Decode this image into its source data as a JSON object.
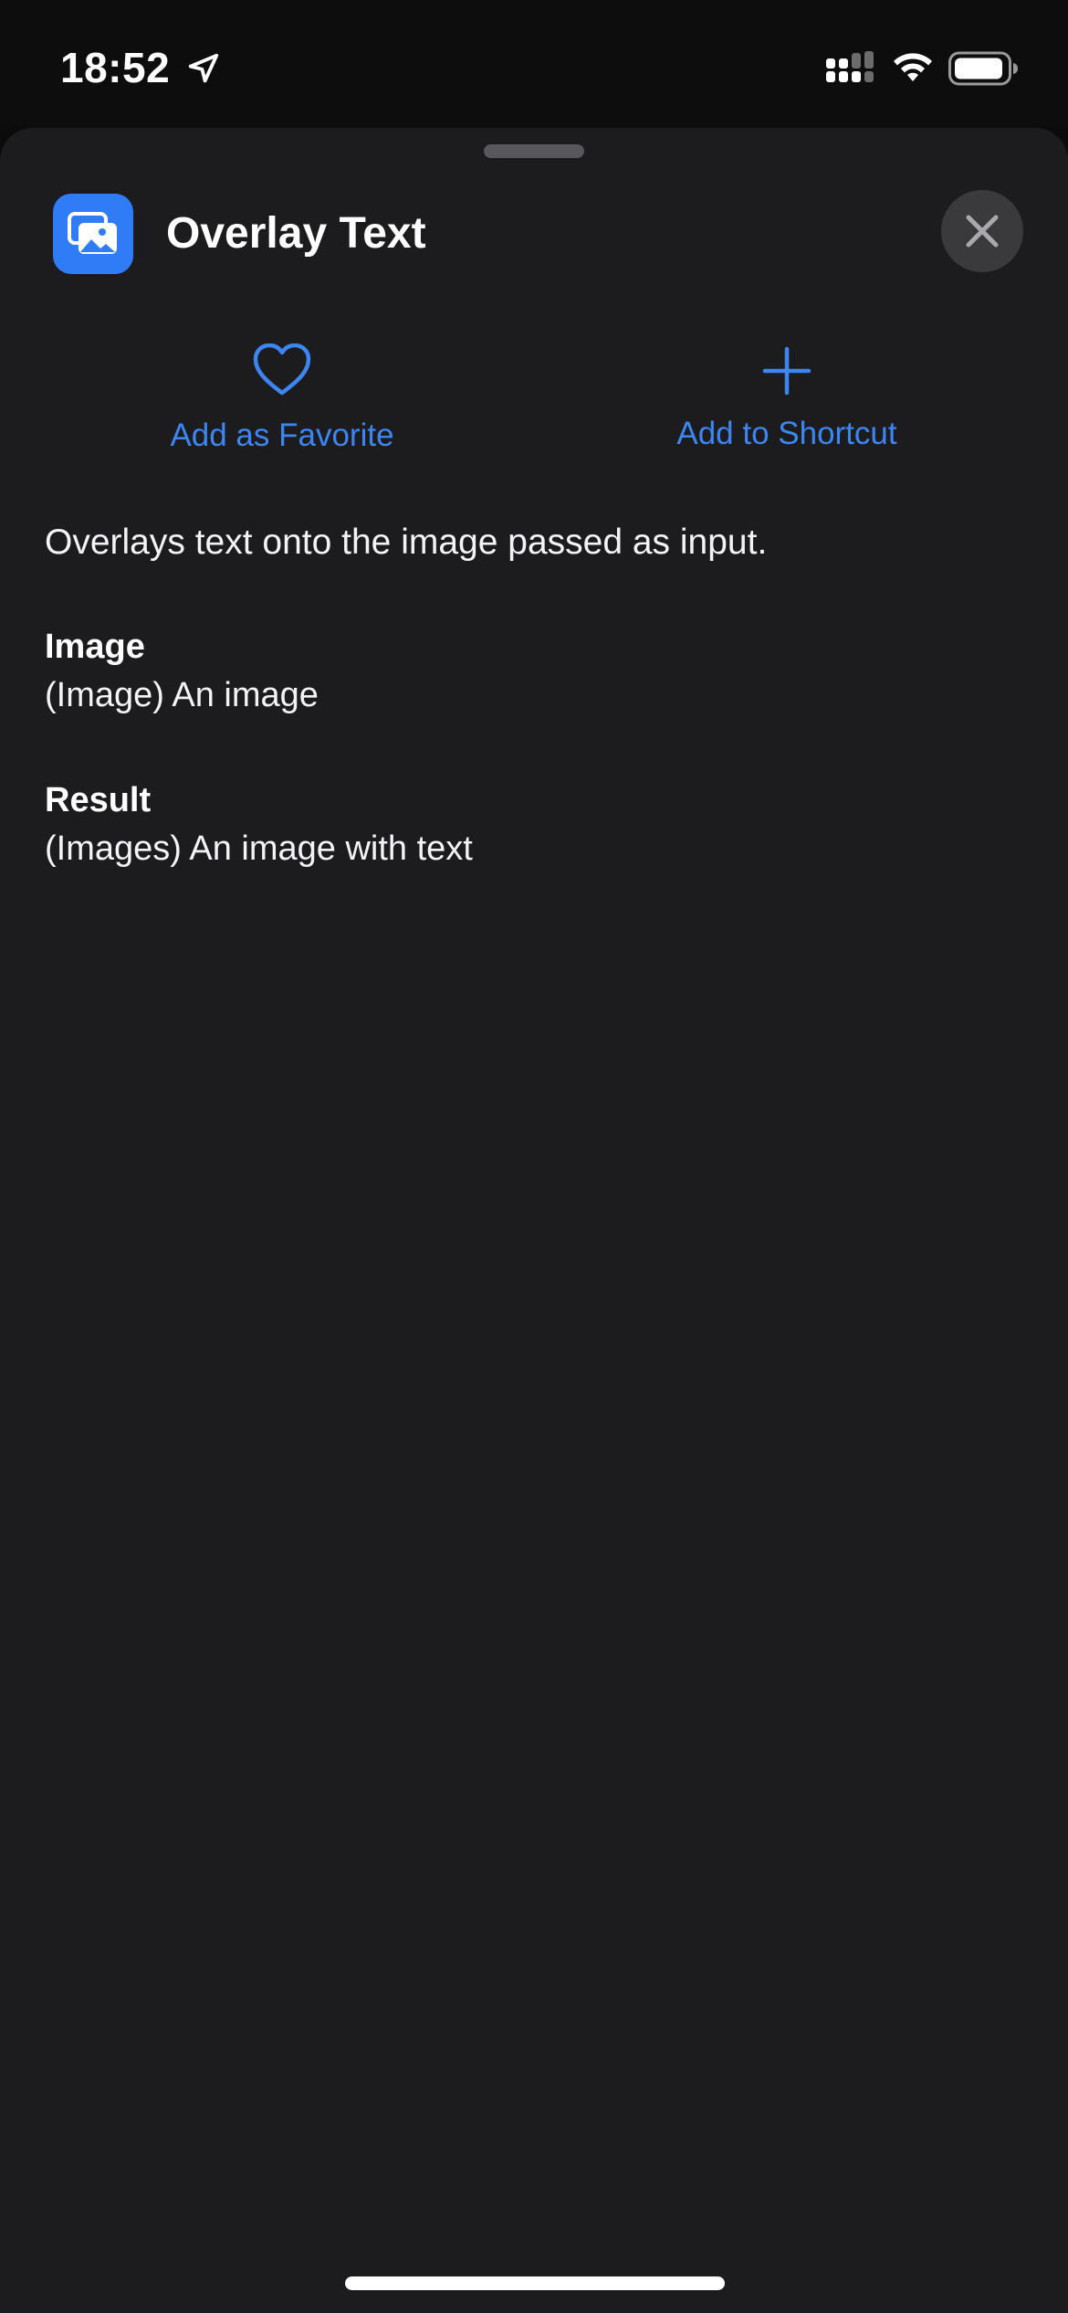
{
  "status_bar": {
    "time": "18:52"
  },
  "sheet": {
    "title": "Overlay Text",
    "app_icon": "photos-icon",
    "accent_color": "#2f7cf6",
    "link_color": "#3d85f0"
  },
  "actions": {
    "favorite_label": "Add as Favorite",
    "add_label": "Add to Shortcut"
  },
  "description": "Overlays text onto the image passed as input.",
  "parameters": [
    {
      "name": "Image",
      "description": "(Image) An image"
    },
    {
      "name": "Result",
      "description": "(Images) An image with text"
    }
  ]
}
